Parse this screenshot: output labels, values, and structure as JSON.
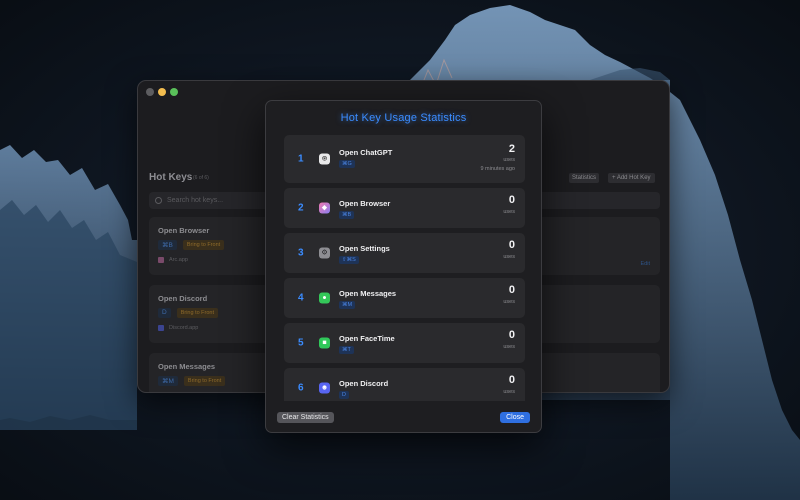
{
  "app_window": {
    "heading": "Hot Keys",
    "count": "(6 of 6)",
    "statistics_label": "Statistics",
    "add_label": "+ Add Hot Key",
    "search_placeholder": "Search hot keys...",
    "cards": [
      {
        "name": "Open Browser",
        "key": "⌘B",
        "bring": "Bring to Front",
        "app": "Arc.app",
        "edit": "Edit"
      },
      {
        "name": "Open Discord",
        "key": "D",
        "bring": "Bring to Front",
        "app": "Discord.app"
      },
      {
        "name": "Open Messages",
        "key": "⌘M",
        "bring": "Bring to Front"
      }
    ]
  },
  "sheet": {
    "title": "Hot Key Usage Statistics",
    "clear_label": "Clear Statistics",
    "close_label": "Close",
    "rows": [
      {
        "rank": "1",
        "name": "Open ChatGPT",
        "key": "⌘G",
        "count": "2",
        "uses": "uses",
        "time": "9 minutes ago",
        "icon": "chatgpt-icon",
        "icon_color": "#e9e9ea"
      },
      {
        "rank": "2",
        "name": "Open Browser",
        "key": "⌘B",
        "count": "0",
        "uses": "uses",
        "icon": "browser-icon",
        "icon_color": "#f07ab0"
      },
      {
        "rank": "3",
        "name": "Open Settings",
        "key": "⇧⌘S",
        "count": "0",
        "uses": "uses",
        "icon": "settings-icon",
        "icon_color": "#9a9a9e"
      },
      {
        "rank": "4",
        "name": "Open Messages",
        "key": "⌘M",
        "count": "0",
        "uses": "uses",
        "icon": "messages-icon",
        "icon_color": "#34c759"
      },
      {
        "rank": "5",
        "name": "Open FaceTime",
        "key": "⌘T",
        "count": "0",
        "uses": "uses",
        "icon": "facetime-icon",
        "icon_color": "#30c85a"
      },
      {
        "rank": "6",
        "name": "Open Discord",
        "key": "D",
        "count": "0",
        "uses": "uses",
        "icon": "discord-icon",
        "icon_color": "#5865f2"
      }
    ]
  }
}
